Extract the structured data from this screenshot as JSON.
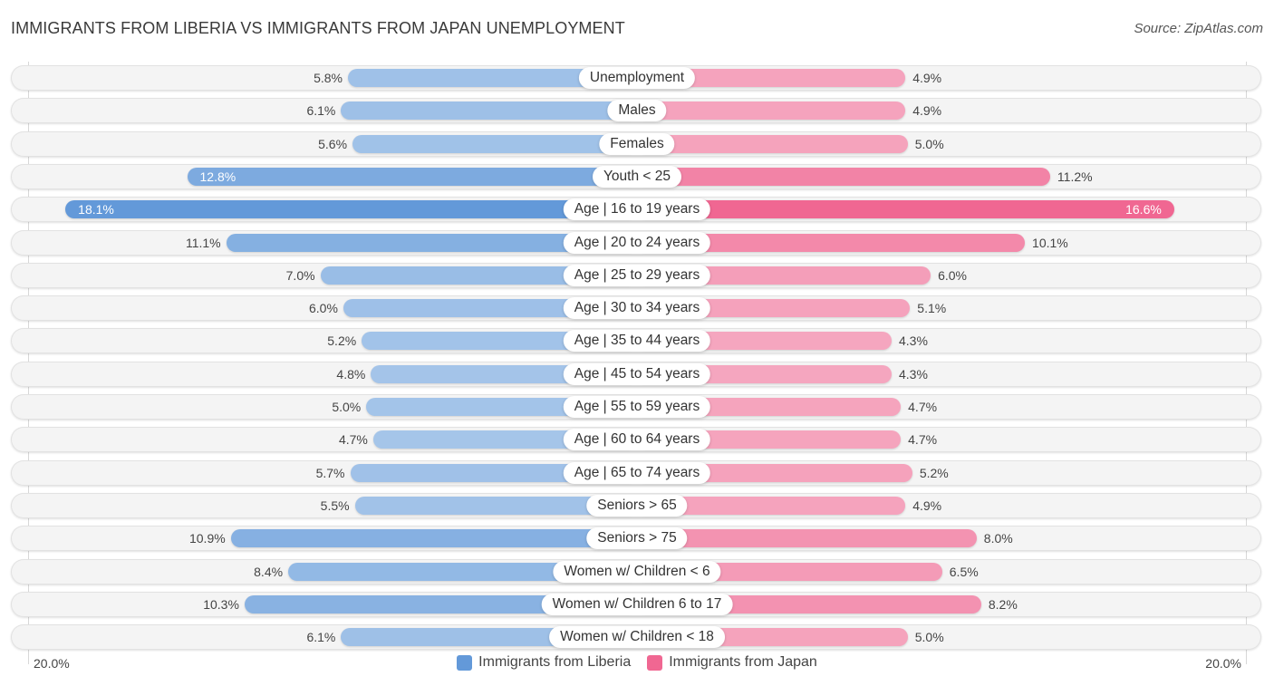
{
  "header": {
    "title": "IMMIGRANTS FROM LIBERIA VS IMMIGRANTS FROM JAPAN UNEMPLOYMENT",
    "source": "Source: ZipAtlas.com"
  },
  "colors": {
    "liberia_strong": "#6399d9",
    "liberia_light": "#a8c7ea",
    "japan_strong": "#f06792",
    "japan_light": "#f5a8c0"
  },
  "chart_data": {
    "type": "bar",
    "orientation": "horizontal-diverging",
    "title": "IMMIGRANTS FROM LIBERIA VS IMMIGRANTS FROM JAPAN UNEMPLOYMENT",
    "xlabel": "",
    "ylabel": "",
    "xlim": [
      -20,
      20
    ],
    "axis_labels": {
      "left": "20.0%",
      "right": "20.0%"
    },
    "legend_position": "bottom-center",
    "categories": [
      "Unemployment",
      "Males",
      "Females",
      "Youth < 25",
      "Age | 16 to 19 years",
      "Age | 20 to 24 years",
      "Age | 25 to 29 years",
      "Age | 30 to 34 years",
      "Age | 35 to 44 years",
      "Age | 45 to 54 years",
      "Age | 55 to 59 years",
      "Age | 60 to 64 years",
      "Age | 65 to 74 years",
      "Seniors > 65",
      "Seniors > 75",
      "Women w/ Children < 6",
      "Women w/ Children 6 to 17",
      "Women w/ Children < 18"
    ],
    "series": [
      {
        "name": "Immigrants from Liberia",
        "side": "left",
        "values": [
          5.8,
          6.1,
          5.6,
          12.8,
          18.1,
          11.1,
          7.0,
          6.0,
          5.2,
          4.8,
          5.0,
          4.7,
          5.7,
          5.5,
          10.9,
          8.4,
          10.3,
          6.1
        ],
        "labels": [
          "5.8%",
          "6.1%",
          "5.6%",
          "12.8%",
          "18.1%",
          "11.1%",
          "7.0%",
          "6.0%",
          "5.2%",
          "4.8%",
          "5.0%",
          "4.7%",
          "5.7%",
          "5.5%",
          "10.9%",
          "8.4%",
          "10.3%",
          "6.1%"
        ]
      },
      {
        "name": "Immigrants from Japan",
        "side": "right",
        "values": [
          4.9,
          4.9,
          5.0,
          11.2,
          16.6,
          10.1,
          6.0,
          5.1,
          4.3,
          4.3,
          4.7,
          4.7,
          5.2,
          4.9,
          8.0,
          6.5,
          8.2,
          5.0
        ],
        "labels": [
          "4.9%",
          "4.9%",
          "5.0%",
          "11.2%",
          "16.6%",
          "10.1%",
          "6.0%",
          "5.1%",
          "4.3%",
          "4.3%",
          "4.7%",
          "4.7%",
          "5.2%",
          "4.9%",
          "8.0%",
          "6.5%",
          "8.2%",
          "5.0%"
        ]
      }
    ]
  },
  "legend": {
    "items": [
      {
        "label": "Immigrants from Liberia",
        "color": "#6399d9"
      },
      {
        "label": "Immigrants from Japan",
        "color": "#f06792"
      }
    ]
  }
}
